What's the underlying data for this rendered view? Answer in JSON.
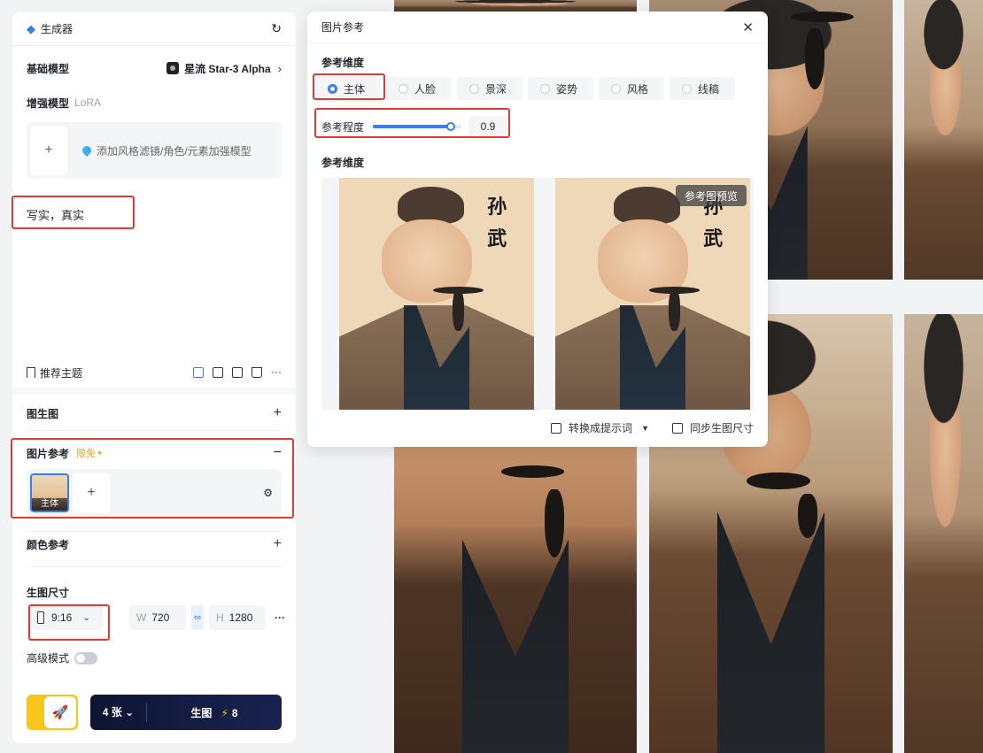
{
  "sidebar": {
    "header_title": "生成器",
    "base_model_label": "基础模型",
    "base_model_value": "星流 Star-3 Alpha",
    "lora_label": "增强模型",
    "lora_sub": "LoRA",
    "lora_hint": "添加风格滤镜/角色/元素加强模型",
    "prompt_text": "写实，真实",
    "recommend_label": "推荐主题",
    "img2img_label": "图生图",
    "img_ref_label": "图片参考",
    "img_ref_badge": "限免",
    "img_ref_thumb_label": "主体",
    "color_ref_label": "颜色参考",
    "size_label": "生图尺寸",
    "ratio_value": "9:16",
    "width_key": "W",
    "width_value": "720",
    "height_key": "H",
    "height_value": "1280",
    "advanced_label": "高级模式",
    "count_value": "4 张",
    "generate_label": "生图",
    "cost_value": "8"
  },
  "popup": {
    "title": "图片参考",
    "dimension_label": "参考维度",
    "dimensions": [
      "主体",
      "人脸",
      "景深",
      "姿势",
      "风格",
      "线稿"
    ],
    "selected_dimension": "主体",
    "strength_label": "参考程度",
    "strength_value": "0.9",
    "strength_fraction": 0.9,
    "section2_label": "参考维度",
    "ref_chars_1": "孙",
    "ref_chars_2": "武",
    "preview_badge": "参考图预览",
    "convert_prompt_label": "转换成提示词",
    "sync_size_label": "同步生图尺寸"
  },
  "colors": {
    "accent": "#3a7cf6",
    "annotation_red": "#e53935",
    "generate_bg": "#0d1533",
    "rocket_yellow": "#f8c51c",
    "free_badge": "#f0a020"
  }
}
